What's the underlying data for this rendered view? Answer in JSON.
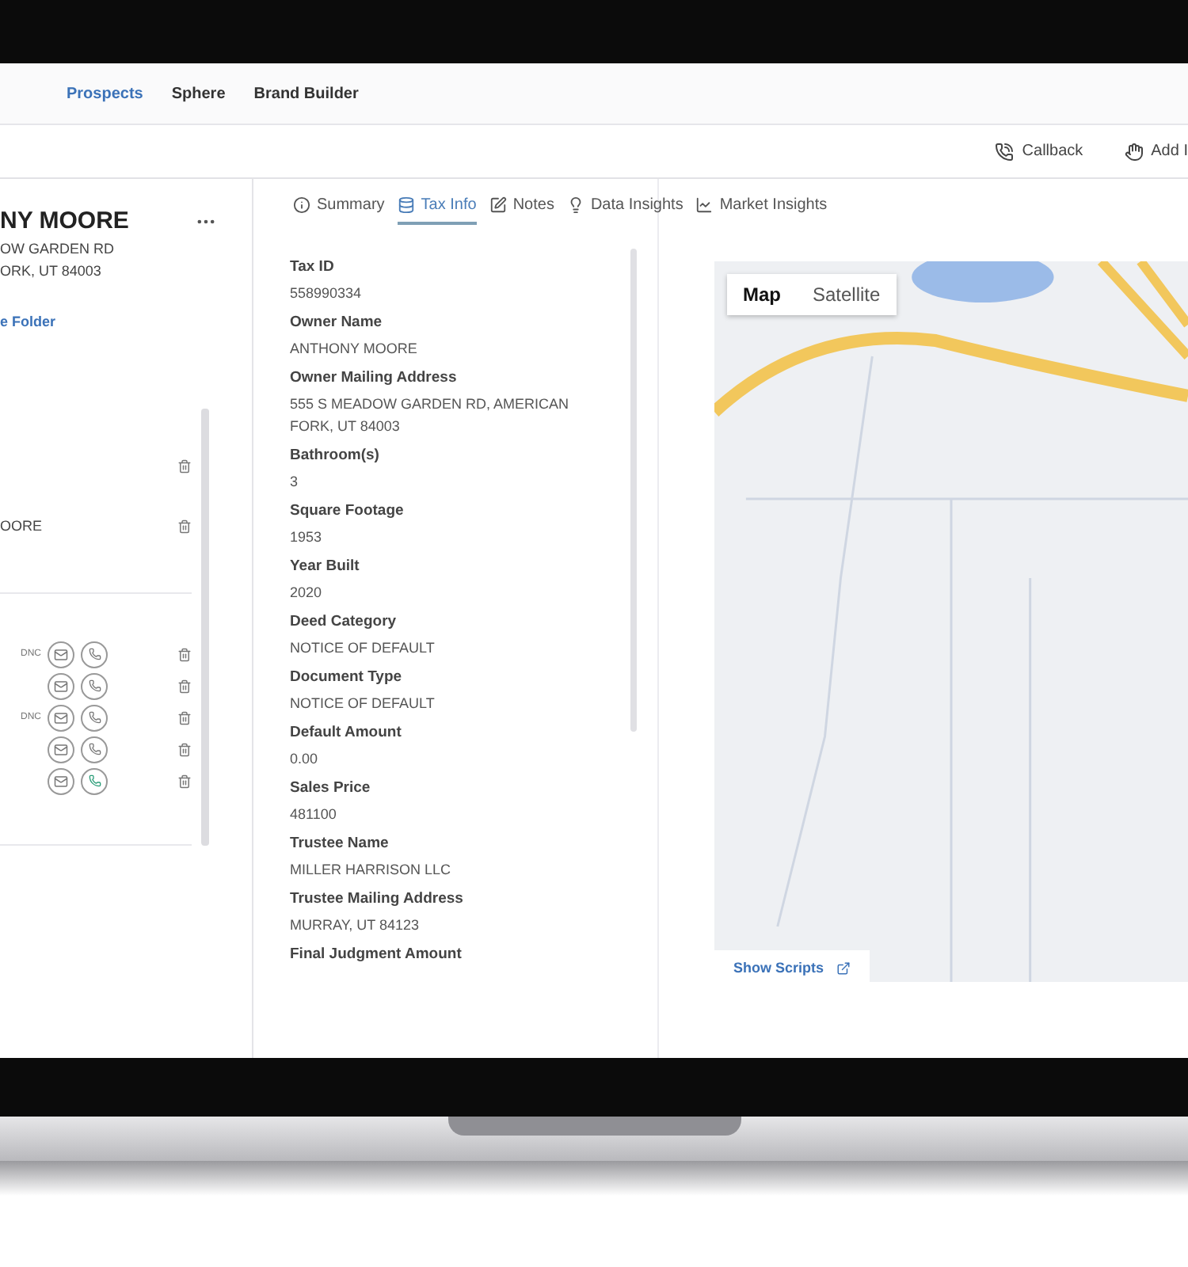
{
  "nav": {
    "items": [
      {
        "label": "Prospects",
        "selected": true
      },
      {
        "label": "Sphere",
        "selected": false
      },
      {
        "label": "Brand Builder",
        "selected": false
      }
    ]
  },
  "toolbar": {
    "buttons": [
      {
        "label": "Callback",
        "kind": "phone"
      },
      {
        "label": "Add I",
        "kind": "hand"
      }
    ]
  },
  "contact": {
    "name": "NY MOORE",
    "address_lines": [
      "OW GARDEN RD",
      "ORK, UT 84003"
    ],
    "folder_link": "e Folder"
  },
  "name_rows": [
    {
      "kind": "empty"
    },
    {
      "kind": "named",
      "text": "OORE"
    }
  ],
  "phones": [
    {
      "kind": "dnc",
      "tag": "DNC",
      "highlighted": false
    },
    {
      "kind": "plain",
      "highlighted": false
    },
    {
      "kind": "dnc",
      "tag": "DNC",
      "highlighted": false
    },
    {
      "kind": "plain",
      "highlighted": false
    },
    {
      "kind": "plain",
      "highlighted": true
    }
  ],
  "tabs": [
    {
      "label": "Summary",
      "kind": "info",
      "selected": false
    },
    {
      "label": "Tax Info",
      "kind": "database",
      "selected": true
    },
    {
      "label": "Notes",
      "kind": "edit",
      "selected": false
    },
    {
      "label": "Data Insights",
      "kind": "bulb",
      "selected": false
    },
    {
      "label": "Market Insights",
      "kind": "chart",
      "selected": false
    }
  ],
  "fields": [
    {
      "label": "Tax ID",
      "value": "558990334"
    },
    {
      "label": "Owner Name",
      "value": "ANTHONY MOORE"
    },
    {
      "label": "Owner Mailing Address",
      "value": "555 S MEADOW GARDEN RD, AMERICAN FORK, UT 84003"
    },
    {
      "label": "Bathroom(s)",
      "value": "3"
    },
    {
      "label": "Square Footage",
      "value": "1953"
    },
    {
      "label": "Year Built",
      "value": "2020"
    },
    {
      "label": "Deed Category",
      "value": "NOTICE OF DEFAULT"
    },
    {
      "label": "Document Type",
      "value": "NOTICE OF DEFAULT"
    },
    {
      "label": "Default Amount",
      "value": "0.00"
    },
    {
      "label": "Sales Price",
      "value": "481100"
    },
    {
      "label": "Trustee Name",
      "value": "MILLER HARRISON LLC"
    },
    {
      "label": "Trustee Mailing Address",
      "value": "MURRAY, UT 84123"
    },
    {
      "label": "Final Judgment Amount"
    }
  ],
  "map": {
    "types": [
      {
        "label": "Map",
        "selected": true
      },
      {
        "label": "Satellite",
        "selected": false
      }
    ],
    "show_scripts": "Show Scripts"
  }
}
